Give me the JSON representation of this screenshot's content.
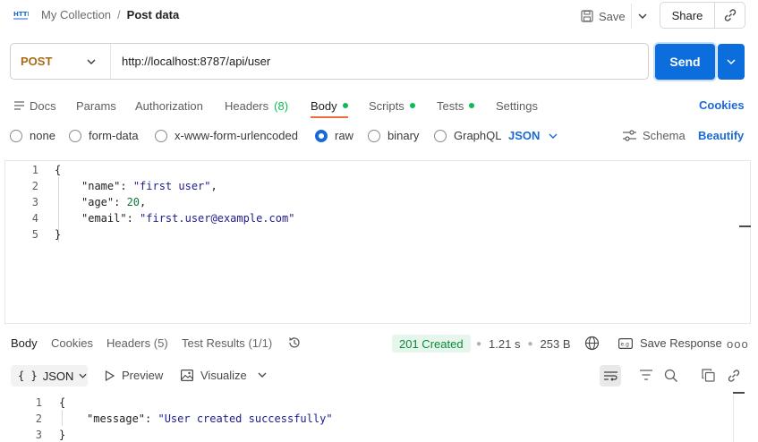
{
  "header": {
    "breadcrumb_collection": "My Collection",
    "breadcrumb_separator": "/",
    "breadcrumb_request": "Post data",
    "save_label": "Save",
    "share_label": "Share",
    "icons": [
      "http-icon",
      "save-icon",
      "chevron-down-icon",
      "link-icon"
    ]
  },
  "request": {
    "method": "POST",
    "url": "http://localhost:8787/api/user",
    "send_label": "Send"
  },
  "request_tabs": {
    "docs": "Docs",
    "params": "Params",
    "authorization": "Authorization",
    "headers": "Headers",
    "headers_count": "(8)",
    "body": "Body",
    "scripts": "Scripts",
    "tests": "Tests",
    "settings": "Settings",
    "cookies": "Cookies",
    "active": "Body"
  },
  "body_types": {
    "none": "none",
    "form_data": "form-data",
    "urlencoded": "x-www-form-urlencoded",
    "raw": "raw",
    "binary": "binary",
    "graphql": "GraphQL",
    "selected": "raw",
    "format": "JSON",
    "schema": "Schema",
    "beautify": "Beautify"
  },
  "editor": {
    "line_numbers": [
      "1",
      "2",
      "3",
      "4",
      "5"
    ],
    "open_brace": "{",
    "close_brace": "}",
    "name_key": "\"name\"",
    "name_value": "\"first user\"",
    "age_key": "\"age\"",
    "age_value": "20",
    "email_key": "\"email\"",
    "email_value": "\"first.user@example.com\"",
    "colon": ": ",
    "comma": ","
  },
  "response_tabs": {
    "body": "Body",
    "cookies": "Cookies",
    "headers": "Headers",
    "headers_count": "(5)",
    "test_results": "Test Results",
    "test_results_count": "(1/1)",
    "active": "Body"
  },
  "response_meta": {
    "status": "201 Created",
    "time": "1.21 s",
    "size": "253 B",
    "save_response": "Save Response",
    "more": "ooo"
  },
  "response_toolbar": {
    "format_braces": "{ }",
    "format": "JSON",
    "preview": "Preview",
    "visualize": "Visualize"
  },
  "response_body": {
    "line_numbers": [
      "1",
      "2",
      "3"
    ],
    "open_brace": "{",
    "close_brace": "}",
    "message_key": "\"message\"",
    "message_value": "\"User created successfully\"",
    "colon": ": "
  },
  "colors": {
    "send": "#0b6edc",
    "method": "#a86a14",
    "link": "#1a6ad6",
    "status_ok": "#0a8a3a",
    "active_tab": "#f26b3a"
  }
}
